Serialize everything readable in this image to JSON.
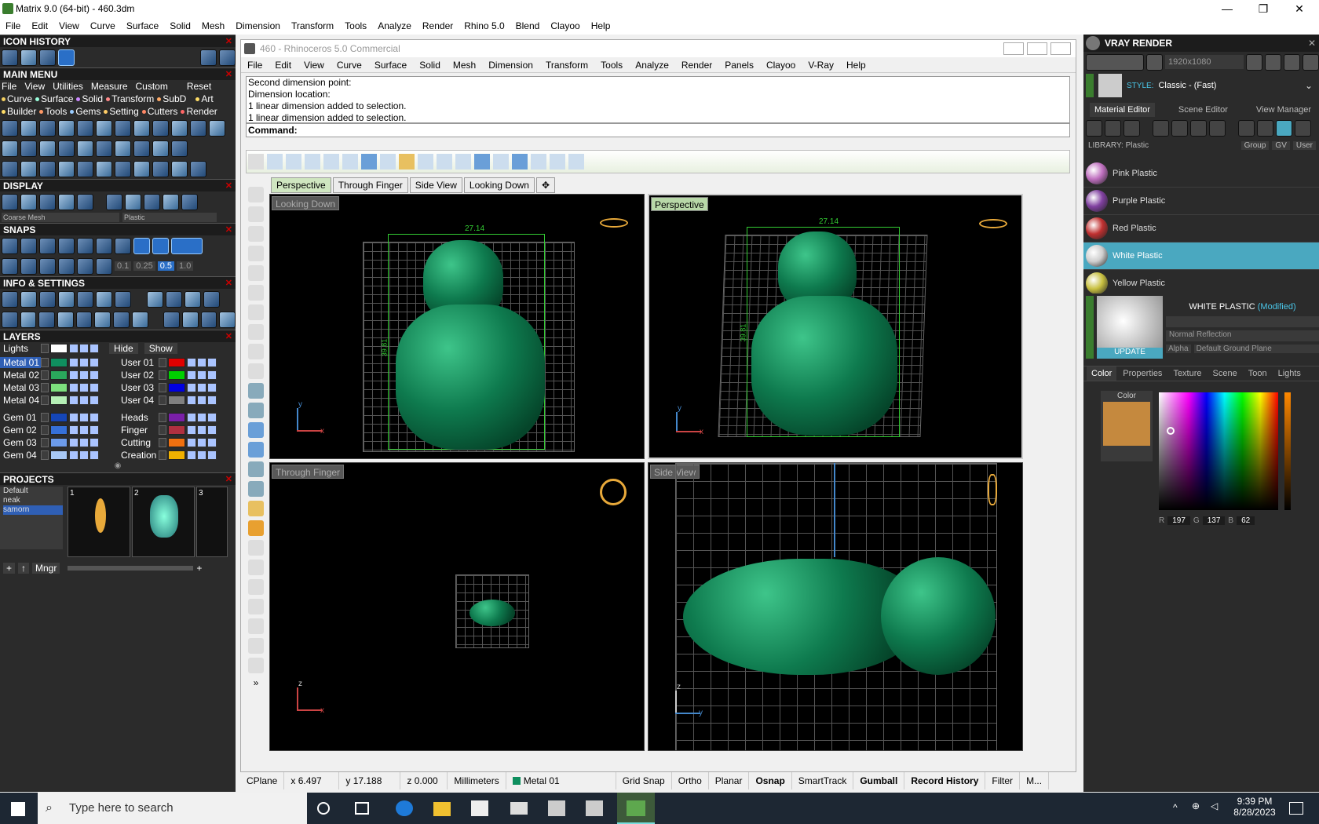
{
  "window": {
    "title": "Matrix 9.0 (64-bit) - 460.3dm",
    "minimize": "—",
    "maximize": "❐",
    "close": "✕"
  },
  "main_menu": [
    "File",
    "Edit",
    "View",
    "Curve",
    "Surface",
    "Solid",
    "Mesh",
    "Dimension",
    "Transform",
    "Tools",
    "Analyze",
    "Render",
    "Rhino 5.0",
    "Blend",
    "Clayoo",
    "Help"
  ],
  "left": {
    "icon_history": "ICON HISTORY",
    "main_menu_title": "MAIN MENU",
    "mm_row1": [
      "File",
      "View",
      "Utilities",
      "Measure",
      "Custom",
      "Reset"
    ],
    "mm_row2": [
      "Curve",
      "Surface",
      "Solid",
      "Transform",
      "SubD",
      "Art"
    ],
    "mm_row3": [
      "Builder",
      "Tools",
      "Gems",
      "Setting",
      "Cutters",
      "Render"
    ],
    "display": "DISPLAY",
    "display_mesh": "Coarse Mesh",
    "display_mat": "Plastic",
    "snaps": "SNAPS",
    "snap_vals": [
      "0.1",
      "0.25",
      "0.5",
      "1.0"
    ],
    "info": "INFO & SETTINGS",
    "layers": "LAYERS",
    "lights": "Lights",
    "hide": "Hide",
    "show": "Show",
    "layers_left": [
      {
        "name": "Metal 01",
        "color": "#0f8f5f"
      },
      {
        "name": "Metal 02",
        "color": "#2aa85c"
      },
      {
        "name": "Metal 03",
        "color": "#7de07d"
      },
      {
        "name": "Metal 04",
        "color": "#b6f0b6"
      },
      {
        "name": "Gem 01",
        "color": "#1546b8"
      },
      {
        "name": "Gem 02",
        "color": "#3670d8"
      },
      {
        "name": "Gem 03",
        "color": "#6c9bea"
      },
      {
        "name": "Gem 04",
        "color": "#a8c8f5"
      }
    ],
    "layers_right": [
      {
        "name": "User 01",
        "color": "#e00000"
      },
      {
        "name": "User 02",
        "color": "#00d000"
      },
      {
        "name": "User 03",
        "color": "#0000e0"
      },
      {
        "name": "User 04",
        "color": "#808080"
      },
      {
        "name": "Heads",
        "color": "#7a1fa8"
      },
      {
        "name": "Finger",
        "color": "#b03040"
      },
      {
        "name": "Cutting",
        "color": "#f07010"
      },
      {
        "name": "Creation",
        "color": "#f0b000"
      }
    ],
    "projects": "PROJECTS",
    "project_list": [
      "Default",
      "neak",
      "samorn"
    ],
    "thumbs": [
      "1",
      "2",
      "3"
    ],
    "mngr": "Mngr"
  },
  "rhino": {
    "title": "460 - Rhinoceros 5.0 Commercial",
    "menu": [
      "File",
      "Edit",
      "View",
      "Curve",
      "Surface",
      "Solid",
      "Mesh",
      "Dimension",
      "Transform",
      "Tools",
      "Analyze",
      "Render",
      "Panels",
      "Clayoo",
      "V-Ray",
      "Help"
    ],
    "history": [
      "Second dimension point:",
      "Dimension location:",
      "1 linear dimension added to selection.",
      "1 linear dimension added to selection."
    ],
    "command": "Command:",
    "tabs": [
      "Perspective",
      "Through Finger",
      "Side View",
      "Looking Down"
    ],
    "vp_tl": "Looking Down",
    "vp_tr": "Perspective",
    "vp_bl": "Through Finger",
    "vp_br": "Side View",
    "dim_w": "27.14",
    "dim_h": "39.81",
    "axis_y": "y",
    "axis_x": "x",
    "axis_z": "z"
  },
  "status": [
    "CPlane",
    "x 6.497",
    "y 17.188",
    "z 0.000",
    "Millimeters",
    "Metal 01",
    "Grid Snap",
    "Ortho",
    "Planar",
    "Osnap",
    "SmartTrack",
    "Gumball",
    "Record History",
    "Filter",
    "M..."
  ],
  "vray": {
    "title": "VRAY RENDER",
    "resolution": "1920x1080",
    "style_label": "STYLE:",
    "style_value": "Classic - (Fast)",
    "tabs": [
      "Material Editor",
      "Scene Editor",
      "View Manager"
    ],
    "library": "LIBRARY: Plastic",
    "group": "Group",
    "gv": "GV",
    "user": "User",
    "materials": [
      {
        "name": "Pink Plastic",
        "color": "#c070c0"
      },
      {
        "name": "Purple Plastic",
        "color": "#8040a0"
      },
      {
        "name": "Red Plastic",
        "color": "#c03030"
      },
      {
        "name": "White Plastic",
        "color": "#cfcfcf"
      },
      {
        "name": "Yellow Plastic",
        "color": "#c8c040"
      }
    ],
    "selected_title": "WHITE PLASTIC",
    "modified": "(Modified)",
    "reflection": "Normal Reflection",
    "alpha": "Alpha",
    "ground": "Default Ground Plane",
    "update": "UPDATE",
    "subtabs": [
      "Color",
      "Properties",
      "Texture",
      "Scene",
      "Toon",
      "Lights"
    ],
    "color_label": "Color",
    "swatch": "#c5893e",
    "r": "197",
    "g": "137",
    "b": "62"
  },
  "taskbar": {
    "search": "Type here to search",
    "time": "9:39 PM",
    "date": "8/28/2023"
  }
}
